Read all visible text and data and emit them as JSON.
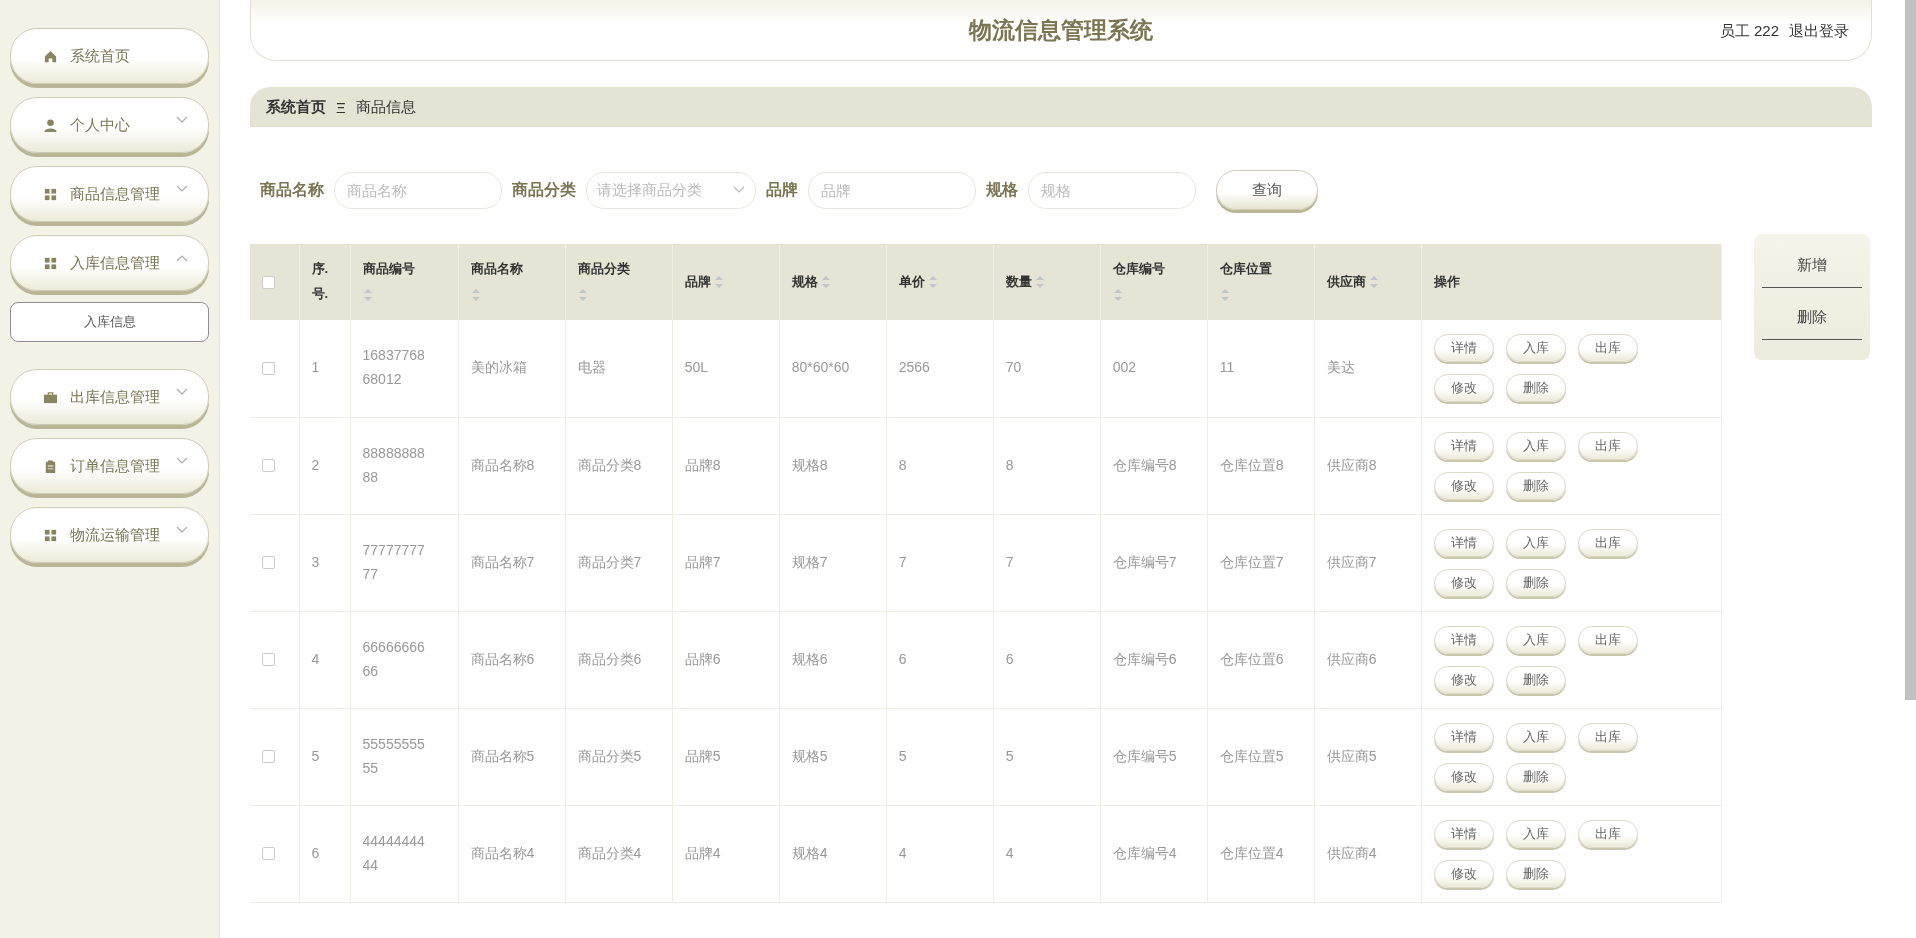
{
  "sidebar": {
    "items": [
      {
        "label": "系统首页"
      },
      {
        "label": "个人中心",
        "expanded": false
      },
      {
        "label": "商品信息管理",
        "expanded": false
      },
      {
        "label": "入库信息管理",
        "expanded": true,
        "children": [
          {
            "label": "入库信息"
          }
        ]
      },
      {
        "label": "出库信息管理",
        "expanded": false
      },
      {
        "label": "订单信息管理",
        "expanded": false
      },
      {
        "label": "物流运输管理",
        "expanded": false
      }
    ]
  },
  "header": {
    "title": "物流信息管理系统",
    "user": "员工 222",
    "logout": "退出登录"
  },
  "breadcrumb": {
    "home": "系统首页",
    "separator": "Ξ",
    "current": "商品信息"
  },
  "search": {
    "fields": [
      {
        "kind": "text",
        "label": "商品名称",
        "placeholder": "商品名称"
      },
      {
        "kind": "select",
        "label": "商品分类",
        "placeholder": "请选择商品分类"
      },
      {
        "kind": "text",
        "label": "品牌",
        "placeholder": "品牌"
      },
      {
        "kind": "text",
        "label": "规格",
        "placeholder": "规格"
      }
    ],
    "button": "查询"
  },
  "side_actions": [
    "新增",
    "删除"
  ],
  "table": {
    "header_checked": false,
    "columns": [
      {
        "label": "序.号.",
        "sortable": false
      },
      {
        "label": "商品编号",
        "sortable": true
      },
      {
        "label": "商品名称",
        "sortable": true
      },
      {
        "label": "商品分类",
        "sortable": true
      },
      {
        "label": "品牌",
        "sortable": true
      },
      {
        "label": "规格",
        "sortable": true
      },
      {
        "label": "单价",
        "sortable": true
      },
      {
        "label": "数量",
        "sortable": true
      },
      {
        "label": "仓库编号",
        "sortable": true
      },
      {
        "label": "仓库位置",
        "sortable": true
      },
      {
        "label": "供应商",
        "sortable": true
      },
      {
        "label": "操作",
        "sortable": false
      }
    ],
    "rows": [
      {
        "checked": false,
        "cells": [
          "1",
          "1683776868012",
          "美的冰箱",
          "电器",
          "50L",
          "80*60*60",
          "2566",
          "70",
          "002",
          "11",
          "美达"
        ],
        "actions": [
          "详情",
          "入库",
          "出库",
          "修改",
          "删除"
        ]
      },
      {
        "checked": false,
        "cells": [
          "2",
          "8888888888",
          "商品名称8",
          "商品分类8",
          "品牌8",
          "规格8",
          "8",
          "8",
          "仓库编号8",
          "仓库位置8",
          "供应商8"
        ],
        "actions": [
          "详情",
          "入库",
          "出库",
          "修改",
          "删除"
        ]
      },
      {
        "checked": false,
        "cells": [
          "3",
          "7777777777",
          "商品名称7",
          "商品分类7",
          "品牌7",
          "规格7",
          "7",
          "7",
          "仓库编号7",
          "仓库位置7",
          "供应商7"
        ],
        "actions": [
          "详情",
          "入库",
          "出库",
          "修改",
          "删除"
        ]
      },
      {
        "checked": false,
        "cells": [
          "4",
          "6666666666",
          "商品名称6",
          "商品分类6",
          "品牌6",
          "规格6",
          "6",
          "6",
          "仓库编号6",
          "仓库位置6",
          "供应商6"
        ],
        "actions": [
          "详情",
          "入库",
          "出库",
          "修改",
          "删除"
        ]
      },
      {
        "checked": false,
        "cells": [
          "5",
          "5555555555",
          "商品名称5",
          "商品分类5",
          "品牌5",
          "规格5",
          "5",
          "5",
          "仓库编号5",
          "仓库位置5",
          "供应商5"
        ],
        "actions": [
          "详情",
          "入库",
          "出库",
          "修改",
          "删除"
        ]
      },
      {
        "checked": false,
        "cells": [
          "6",
          "4444444444",
          "商品名称4",
          "商品分类4",
          "品牌4",
          "规格4",
          "4",
          "4",
          "仓库编号4",
          "仓库位置4",
          "供应商4"
        ],
        "actions": [
          "详情",
          "入库",
          "出库",
          "修改",
          "删除"
        ]
      }
    ]
  }
}
